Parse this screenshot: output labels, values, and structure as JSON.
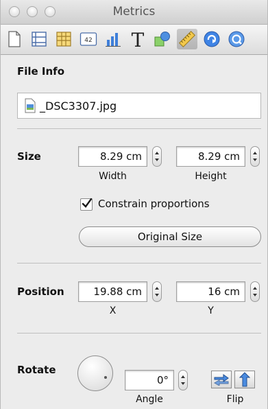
{
  "window": {
    "title": "Metrics"
  },
  "toolbar": {
    "icons": [
      "document-icon",
      "layout-icon",
      "table-icon",
      "number-icon",
      "chart-icon",
      "text-icon",
      "shapes-icon",
      "ruler-icon",
      "link-icon",
      "quicktime-icon"
    ],
    "active": "ruler-icon"
  },
  "file_info": {
    "label": "File Info",
    "filename": "_DSC3307.jpg"
  },
  "size": {
    "label": "Size",
    "width_value": "8.29 cm",
    "width_label": "Width",
    "height_value": "8.29 cm",
    "height_label": "Height",
    "constrain_label": "Constrain proportions",
    "constrain_checked": true,
    "original_size_label": "Original Size"
  },
  "position": {
    "label": "Position",
    "x_value": "19.88 cm",
    "x_label": "X",
    "y_value": "16 cm",
    "y_label": "Y"
  },
  "rotate": {
    "label": "Rotate",
    "angle_value": "0°",
    "angle_label": "Angle",
    "flip_label": "Flip"
  },
  "colors": {
    "accent": "#3b7bd6",
    "chrome": "#ececec"
  }
}
